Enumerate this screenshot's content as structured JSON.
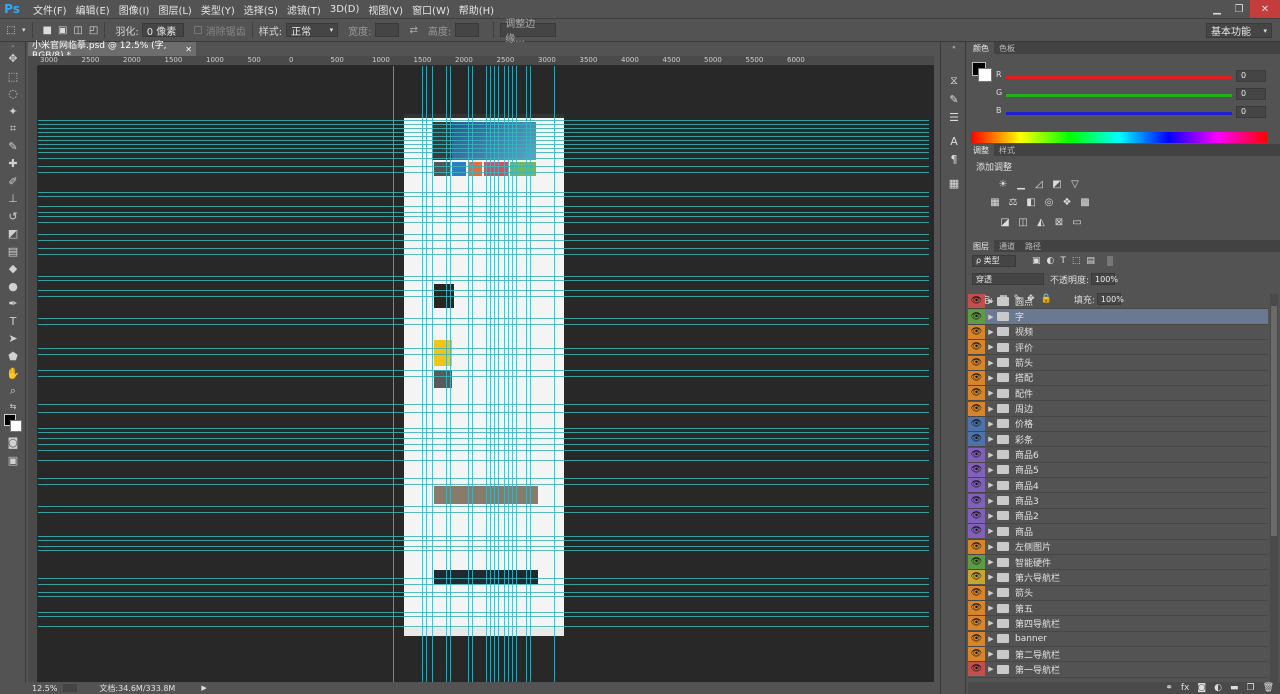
{
  "app": {
    "logo": "Ps"
  },
  "menu": [
    "文件(F)",
    "编辑(E)",
    "图像(I)",
    "图层(L)",
    "类型(Y)",
    "选择(S)",
    "滤镜(T)",
    "3D(D)",
    "视图(V)",
    "窗口(W)",
    "帮助(H)"
  ],
  "options": {
    "feather_label": "羽化:",
    "feather_value": "0 像素",
    "antialias_label": "消除锯齿",
    "style_label": "样式:",
    "style_value": "正常",
    "width_label": "宽度:",
    "height_label": "高度:",
    "refine_edge": "调整边缘...",
    "workspace": "基本功能"
  },
  "document": {
    "tab_title": "小米官网临摹.psd @ 12.5% (字, RGB/8) *",
    "zoom": "12.5%",
    "doc_info": "文档:34.6M/333.8M",
    "ruler_labels": [
      "3000",
      "2500",
      "2000",
      "1500",
      "1000",
      "500",
      "0",
      "500",
      "1000",
      "1500",
      "2000",
      "2500",
      "3000",
      "3500",
      "4000",
      "4500",
      "5000",
      "5500",
      "6000"
    ]
  },
  "color_panel": {
    "tabs": [
      "颜色",
      "色板"
    ],
    "r_label": "R",
    "g_label": "G",
    "b_label": "B",
    "r_value": "0",
    "g_value": "0",
    "b_value": "0",
    "r_color": "#e02020",
    "g_color": "#20b020",
    "b_color": "#2020d0"
  },
  "adjustments_panel": {
    "tabs": [
      "调整",
      "样式"
    ],
    "title": "添加调整"
  },
  "layers_panel": {
    "tabs": [
      "图层",
      "通道",
      "路径"
    ],
    "kind_filter": "ρ 类型",
    "blend_mode": "穿透",
    "opacity_label": "不透明度:",
    "opacity_value": "100%",
    "lock_label": "锁定:",
    "fill_label": "填充:",
    "fill_value": "100%",
    "layers": [
      {
        "name": "圆点",
        "color": "red"
      },
      {
        "name": "字",
        "color": "green",
        "selected": true
      },
      {
        "name": "视频",
        "color": "orange"
      },
      {
        "name": "评价",
        "color": "orange"
      },
      {
        "name": "箭头",
        "color": "orange"
      },
      {
        "name": "搭配",
        "color": "orange"
      },
      {
        "name": "配件",
        "color": "orange"
      },
      {
        "name": "周边",
        "color": "orange"
      },
      {
        "name": "价格",
        "color": "blue"
      },
      {
        "name": "彩条",
        "color": "blue"
      },
      {
        "name": "商品6",
        "color": "violet"
      },
      {
        "name": "商品5",
        "color": "violet"
      },
      {
        "name": "商品4",
        "color": "violet"
      },
      {
        "name": "商品3",
        "color": "violet"
      },
      {
        "name": "商品2",
        "color": "violet"
      },
      {
        "name": "商品",
        "color": "violet"
      },
      {
        "name": "左侧图片",
        "color": "orange"
      },
      {
        "name": "智能硬件",
        "color": "green"
      },
      {
        "name": "第六导航栏",
        "color": "yellow"
      },
      {
        "name": "箭头",
        "color": "orange"
      },
      {
        "name": "第五",
        "color": "orange"
      },
      {
        "name": "第四导航栏",
        "color": "orange"
      },
      {
        "name": "banner",
        "color": "orange"
      },
      {
        "name": "第二导航栏",
        "color": "orange"
      },
      {
        "name": "第一导航栏",
        "color": "red"
      }
    ]
  }
}
